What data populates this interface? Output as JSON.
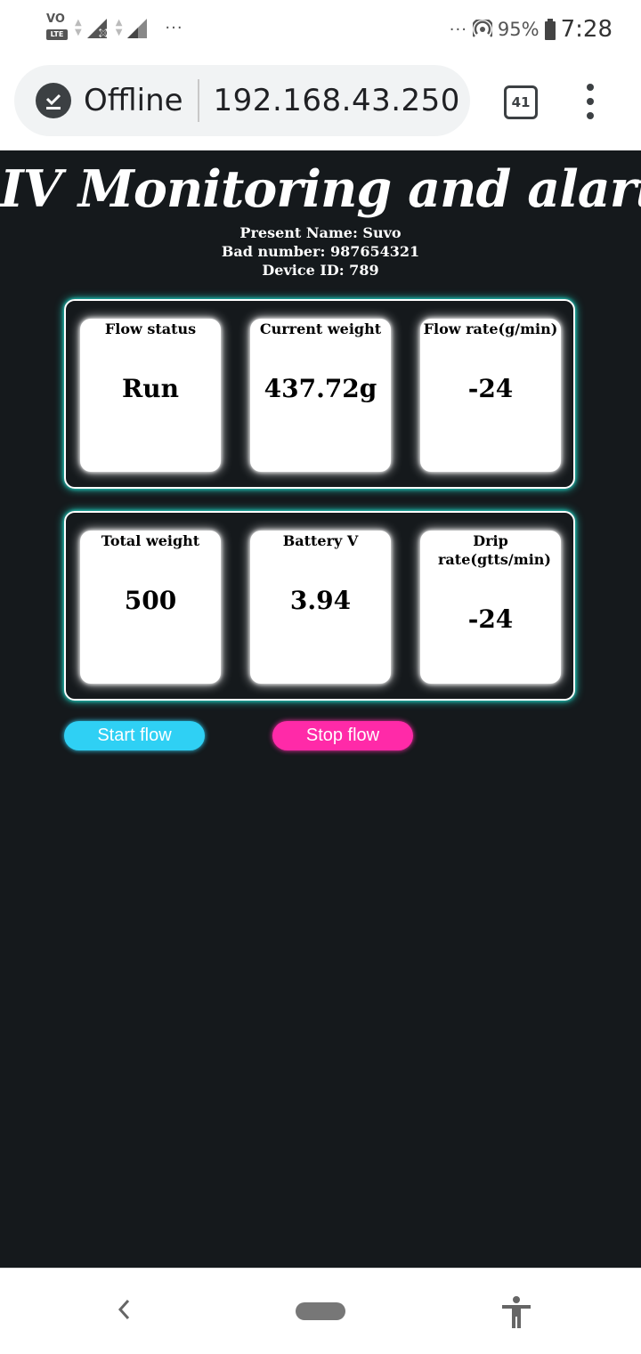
{
  "status_bar": {
    "volte_top": "VO",
    "volte_bottom": "LTE",
    "left_dots": "···",
    "right_dots": "···",
    "battery_percent": "95%",
    "time": "7:28",
    "icons": [
      "volte-icon",
      "data-arrows-icon",
      "signal-no-data-icon",
      "signal-icon",
      "hotspot-icon",
      "battery-icon"
    ]
  },
  "browser": {
    "status_label": "Offline",
    "url": "192.168.43.250",
    "tab_count": "41"
  },
  "page": {
    "title": "IV Monitoring and alart",
    "patient_line": "Present Name: Suvo",
    "bed_line": "Bad number: 987654321",
    "device_line": "Device ID: 789",
    "colors": {
      "background": "#15191c",
      "panel_glow": "#1fd6c6",
      "start_button": "#2fd0f4",
      "stop_button": "#ff2aa8"
    },
    "cards_row1": [
      {
        "label": "Flow status",
        "value": "Run"
      },
      {
        "label": "Current weight",
        "value": "437.72g"
      },
      {
        "label": "Flow rate(g/min)",
        "value": "-24"
      }
    ],
    "cards_row2": [
      {
        "label": "Total weight",
        "value": "500"
      },
      {
        "label": "Battery V",
        "value": "3.94"
      },
      {
        "label": "Drip rate(gtts/min)",
        "value": "-24"
      }
    ],
    "start_label": "Start flow",
    "stop_label": "Stop flow"
  },
  "nav": {
    "icons": [
      "back-icon",
      "home-pill-icon",
      "accessibility-icon"
    ]
  }
}
